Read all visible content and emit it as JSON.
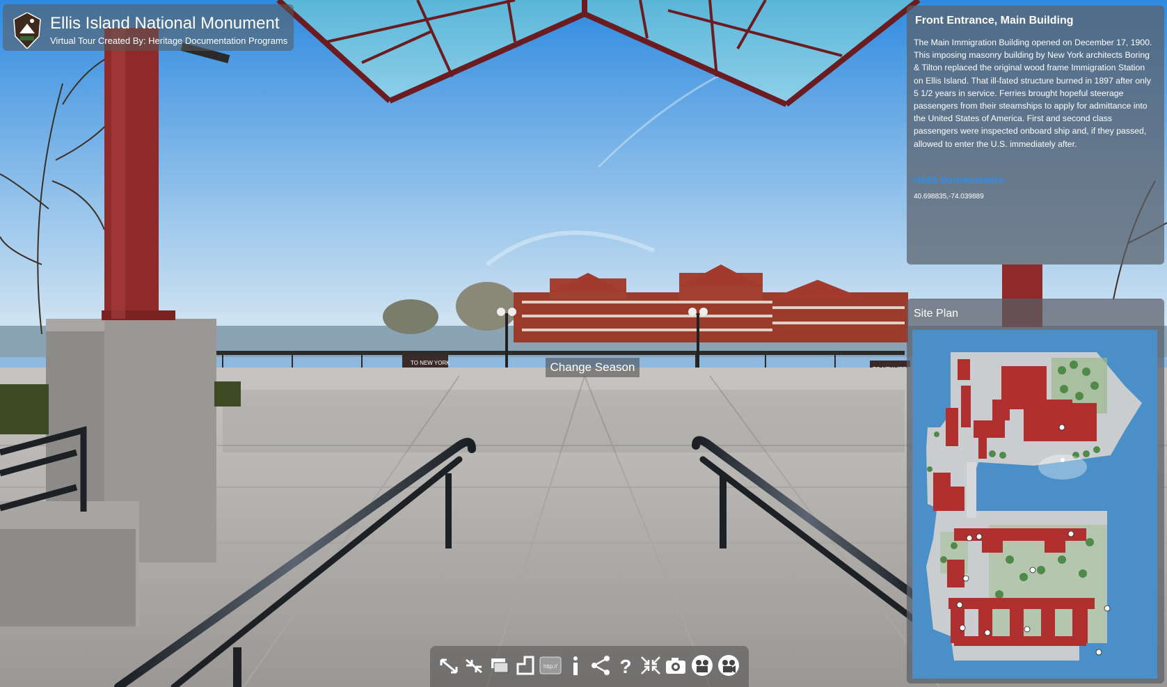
{
  "header": {
    "title": "Ellis Island National Monument",
    "subtitle": "Virtual Tour Created By: Heritage Documentation Programs",
    "logo_icon": "national-park-service-arrowhead-icon"
  },
  "info_panel": {
    "title": "Front Entrance, Main Building",
    "description": "The Main Immigration Building opened on December 17, 1900. This imposing masonry building by New York architects Boring & Tilton replaced the original wood frame Immigration Station on Ellis Island.  That ill-fated structure burned in 1897 after only 5 1/2 years in service. Ferries brought hopeful steerage passengers from their steamships to apply for admittance into the United States of America. First and second class passengers were inspected onboard ship and, if they passed, allowed to enter the U.S. immediately after.",
    "link_label": "HABS Documentation",
    "coordinates": "40.698835,-74.039889",
    "link_color": "#2f8fe8"
  },
  "site_plan": {
    "title": "Site Plan",
    "building_color": "#b03030",
    "water_color": "#4a8fc8",
    "ground_color": "#c9cdd0"
  },
  "scene": {
    "change_season_label": "Change Season",
    "sign_left": "TO NEW YORK",
    "sign_right": "TO NEW JERSEY"
  },
  "toolbar": {
    "buttons": [
      {
        "icon": "zoom-in-icon"
      },
      {
        "icon": "zoom-out-icon"
      },
      {
        "icon": "gallery-icon"
      },
      {
        "icon": "floorplan-icon"
      },
      {
        "icon": "link-icon",
        "label": "http://"
      },
      {
        "icon": "info-icon"
      },
      {
        "icon": "share-icon"
      },
      {
        "icon": "help-icon"
      },
      {
        "icon": "fullscreen-icon"
      },
      {
        "icon": "snapshot-camera-icon"
      },
      {
        "icon": "autorotate-icon"
      },
      {
        "icon": "video-tour-icon"
      }
    ]
  }
}
